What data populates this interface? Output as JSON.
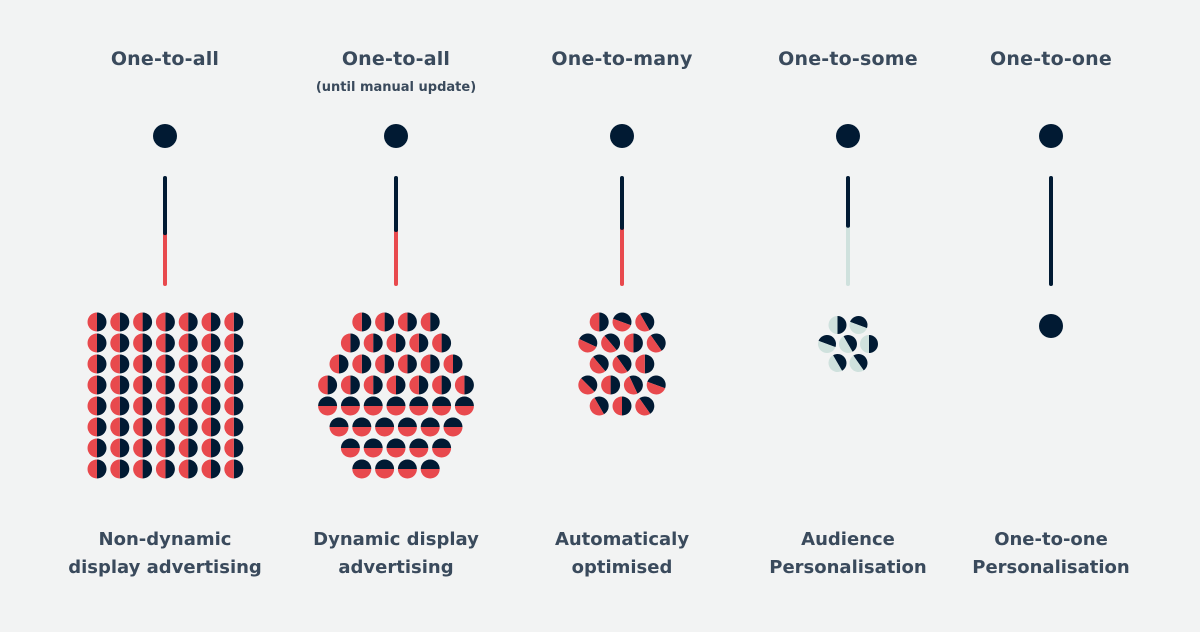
{
  "colors": {
    "background": "#f2f3f3",
    "dark": "#011a33",
    "red": "#e8494d",
    "light": "#cfe1dd",
    "text": "#3a4a5c"
  },
  "stages": [
    {
      "heading": "One-to-all",
      "subheading": "",
      "footer": [
        "Non-dynamic",
        "display advertising"
      ],
      "bar": {
        "dark_fraction": 0.52,
        "rest_color": "red"
      },
      "cluster": {
        "shape": "grid",
        "rows": [
          7,
          7,
          7,
          7,
          7,
          7,
          7,
          7
        ],
        "split": "vertical",
        "colors": [
          "red",
          "dark"
        ]
      }
    },
    {
      "heading": "One-to-all",
      "subheading": "(until manual update)",
      "footer": [
        "Dynamic display",
        "advertising"
      ],
      "bar": {
        "dark_fraction": 0.49,
        "rest_color": "red"
      },
      "cluster": {
        "shape": "hexagon",
        "rows": [
          4,
          5,
          6,
          7,
          7,
          6,
          5,
          4
        ],
        "split": "vertical-then-horizontal",
        "colors": [
          "red",
          "dark"
        ]
      }
    },
    {
      "heading": "One-to-many",
      "subheading": "",
      "footer": [
        "Automaticaly",
        "optimised"
      ],
      "bar": {
        "dark_fraction": 0.47,
        "rest_color": "red"
      },
      "cluster": {
        "shape": "hexagon",
        "rows": [
          3,
          4,
          3,
          4,
          3
        ],
        "split": "mixed-angles",
        "colors": [
          "red",
          "dark"
        ]
      }
    },
    {
      "heading": "One-to-some",
      "subheading": "",
      "footer": [
        "Audience",
        "Personalisation"
      ],
      "bar": {
        "dark_fraction": 0.45,
        "rest_color": "light"
      },
      "cluster": {
        "shape": "hexagon",
        "rows": [
          2,
          3,
          2
        ],
        "split": "mixed-angles",
        "colors": [
          "light",
          "dark"
        ]
      }
    },
    {
      "heading": "One-to-one",
      "subheading": "",
      "footer": [
        "One-to-one",
        "Personalisation"
      ],
      "bar": {
        "dark_fraction": 1.0,
        "rest_color": "dark"
      },
      "cluster": {
        "shape": "single",
        "rows": [
          1
        ],
        "split": "none",
        "colors": [
          "dark"
        ]
      }
    }
  ]
}
